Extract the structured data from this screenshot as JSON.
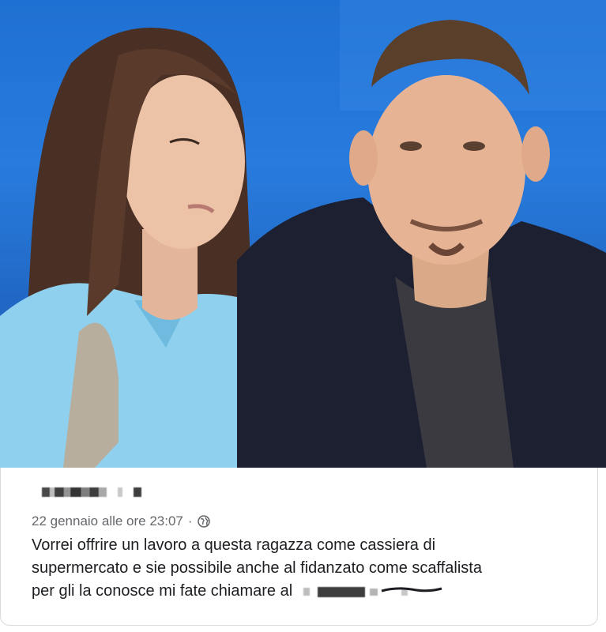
{
  "photo": {
    "subject_left": "woman in light-blue blouse",
    "subject_right": "man in dark jacket"
  },
  "post": {
    "author": "",
    "timestamp": "22 gennaio alle ore 23:07",
    "separator": "·",
    "audience_icon": "globe-icon",
    "text_line1": "Vorrei offrire un lavoro a questa ragazza come cassiera di",
    "text_line2": "supermercato e sie possibile anche al fidanzato come scaffalista",
    "text_line3": "per gli la conosce mi fate chiamare al"
  },
  "colors": {
    "studio_blue": "#2a7fe0",
    "meta_gray": "#65676b",
    "text": "#1c1e21"
  }
}
